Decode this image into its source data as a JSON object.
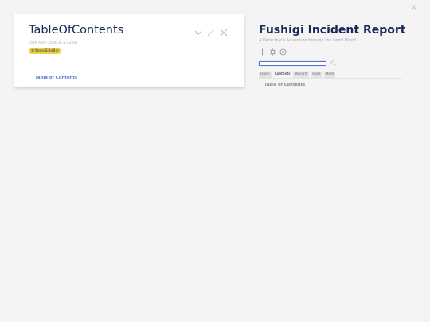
{
  "tiddler": {
    "title": "TableOfContents",
    "date": "25th April 2020 at 4:42pm",
    "tag": "$:/tags/SideBar",
    "body_link": "Table of Contents",
    "controls": [
      "more-icon",
      "edit-icon",
      "close-icon"
    ]
  },
  "sidebar": {
    "site_title": "Fushigi Incident Report",
    "site_subtitle": "A Detective's Adventure through the Spirit World",
    "page_controls": [
      "new-tiddler-icon",
      "control-panel-icon",
      "save-icon"
    ],
    "search": {
      "value": "",
      "placeholder": ""
    },
    "tabs": [
      {
        "label": "Open",
        "active": false
      },
      {
        "label": "Contents",
        "active": true
      },
      {
        "label": "Recent",
        "active": false
      },
      {
        "label": "Tools",
        "active": false
      },
      {
        "label": "More",
        "active": false
      }
    ],
    "tab_content_item": "Table of Contents"
  },
  "colors": {
    "title": "#182955",
    "tag_bg": "#ead24d",
    "link": "#5778d8",
    "background": "#f4f4f4",
    "search_border": "#4a78c9"
  }
}
